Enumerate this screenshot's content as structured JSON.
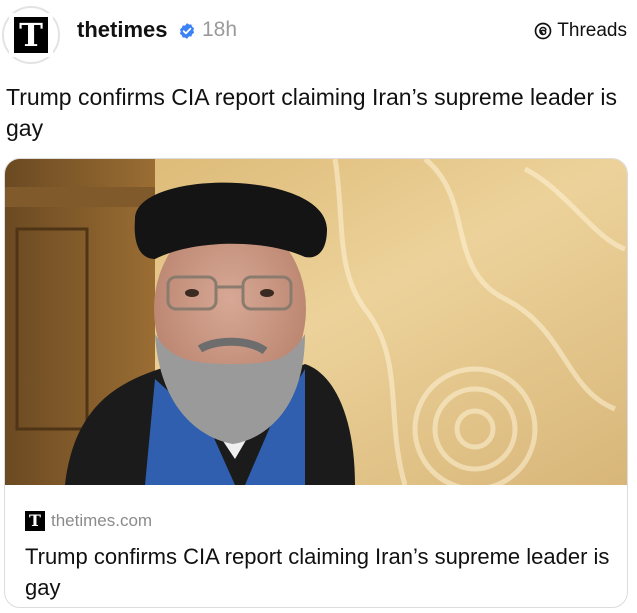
{
  "post": {
    "author": "thetimes",
    "avatar_letter": "T",
    "time_ago": "18h",
    "platform_label": "Threads",
    "text": "Trump confirms CIA report claiming Iran’s supreme leader is gay"
  },
  "link_card": {
    "source_logo_letter": "T",
    "domain": "thetimes.com",
    "title": "Trump confirms CIA report claiming Iran’s supreme leader is gay"
  },
  "colors": {
    "verified_badge": "#3b82f6",
    "timestamp": "#9a9a9a",
    "domain": "#8b8b8b"
  },
  "icons": [
    "verified-badge-icon",
    "threads-logo-icon"
  ]
}
